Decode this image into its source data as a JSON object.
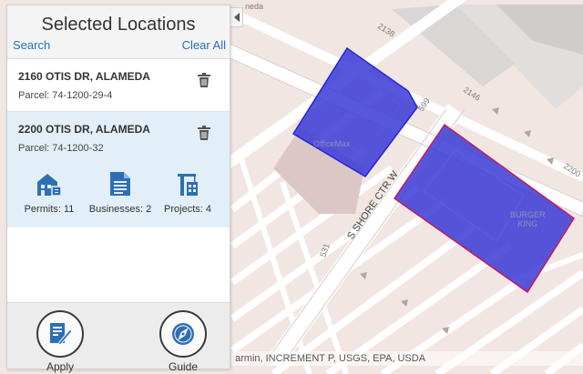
{
  "panel": {
    "title": "Selected Locations",
    "search_label": "Search",
    "clear_label": "Clear All",
    "locations": [
      {
        "address": "2160 OTIS DR, ALAMEDA",
        "parcel": "Parcel: 74-1200-29-4"
      },
      {
        "address": "2200 OTIS DR, ALAMEDA",
        "parcel": "Parcel: 74-1200-32"
      }
    ],
    "stats": {
      "permits": "Permits: 11",
      "businesses": "Businesses: 2",
      "projects": "Projects: 4"
    },
    "footer": {
      "apply_label": "Apply",
      "guide_label": "Guide"
    }
  },
  "map": {
    "street_name": "S SHORE CTR W",
    "labels": {
      "top": "neda",
      "n2138": "2138",
      "n599": "599",
      "n2146": "2146",
      "n2200": "2200",
      "n531": "531"
    },
    "poi": {
      "officemax": "OfficeMax",
      "burger_king_1": "BURGER",
      "burger_king_2": "KING"
    },
    "attribution": "armin, INCREMENT P, USGS, EPA, USDA"
  },
  "colors": {
    "selection_fill": "#3a3ad6",
    "selection_outline_1": "#2424e0",
    "selection_outline_2": "#c8185a",
    "accent_link": "#2a6fb7",
    "icon_blue": "#2d6fb3"
  },
  "icons": {
    "permits": "permits-building-icon",
    "businesses": "businesses-document-icon",
    "projects": "projects-crane-icon",
    "apply": "apply-form-icon",
    "guide": "guide-compass-icon",
    "delete": "trash-icon"
  }
}
